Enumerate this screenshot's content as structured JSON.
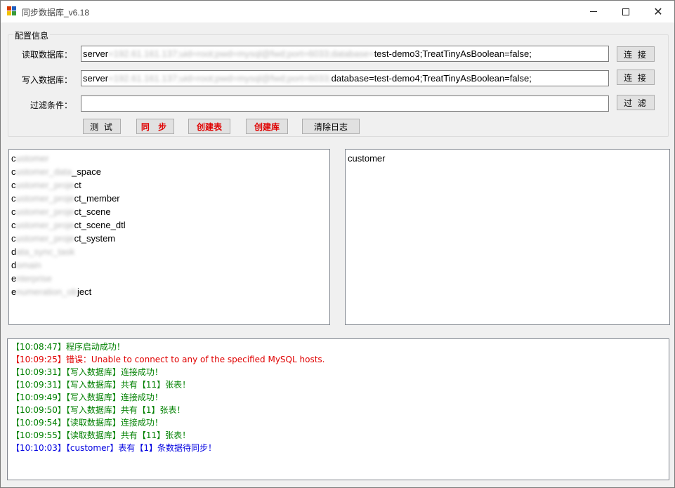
{
  "window": {
    "title": "同步数据库_v6.18",
    "colors": {
      "icon_red": "#d83b01",
      "icon_blue": "#1f5fbf",
      "icon_yellow": "#f2c200",
      "icon_green": "#3a9a3a"
    }
  },
  "config": {
    "group_title": "配置信息",
    "read_label": "读取数据库：",
    "read_prefix": "server",
    "read_hidden": "=192.61.161.137;uid=root;pwd=mysql@fwd;port=6033;database=",
    "read_suffix": "test-demo3;TreatTinyAsBoolean=false;",
    "write_label": "写入数据库：",
    "write_prefix": "server",
    "write_hidden": "=192.61.161.137;uid=root;pwd=mysql@fwd;port=6033;",
    "write_suffix": "database=test-demo4;TreatTinyAsBoolean=false;",
    "filter_label": "过滤条件：",
    "filter_value": "",
    "connect_read_label": "连 接",
    "connect_write_label": "连 接",
    "filter_button_label": "过 滤"
  },
  "actions": {
    "test_label": "测 试",
    "sync_label": "同 步",
    "create_table_label": "创建表",
    "create_db_label": "创建库",
    "clear_log_label": "清除日志"
  },
  "source_tables": [
    {
      "head": "c",
      "hidden": "ustomer",
      "tail": ""
    },
    {
      "head": "c",
      "hidden": "ustomer_data",
      "tail": "_space"
    },
    {
      "head": "c",
      "hidden": "ustomer_proje",
      "tail": "ct"
    },
    {
      "head": "c",
      "hidden": "ustomer_proje",
      "tail": "ct_member"
    },
    {
      "head": "c",
      "hidden": "ustomer_proje",
      "tail": "ct_scene"
    },
    {
      "head": "c",
      "hidden": "ustomer_proje",
      "tail": "ct_scene_dtl"
    },
    {
      "head": "c",
      "hidden": "ustomer_proje",
      "tail": "ct_system"
    },
    {
      "head": "d",
      "hidden": "ata_sync_task",
      "tail": ""
    },
    {
      "head": "d",
      "hidden": "omain",
      "tail": ""
    },
    {
      "head": "e",
      "hidden": "nterprise",
      "tail": ""
    },
    {
      "head": "e",
      "hidden": "numeration_ob",
      "tail": "ject"
    }
  ],
  "target_tables": [
    "customer"
  ],
  "log": [
    {
      "color": "green",
      "text": "【10:08:47】程序启动成功！"
    },
    {
      "color": "red",
      "text": "【10:09:25】错误：Unable to connect to any of the specified MySQL hosts."
    },
    {
      "color": "green",
      "text": "【10:09:31】【写入数据库】连接成功！"
    },
    {
      "color": "green",
      "text": "【10:09:31】【写入数据库】共有【11】张表！"
    },
    {
      "color": "green",
      "text": "【10:09:49】【写入数据库】连接成功！"
    },
    {
      "color": "green",
      "text": "【10:09:50】【写入数据库】共有【1】张表！"
    },
    {
      "color": "green",
      "text": "【10:09:54】【读取数据库】连接成功！"
    },
    {
      "color": "green",
      "text": "【10:09:55】【读取数据库】共有【11】张表！"
    },
    {
      "color": "blue",
      "text": "【10:10:03】【customer】表有【1】条数据待同步！"
    }
  ]
}
